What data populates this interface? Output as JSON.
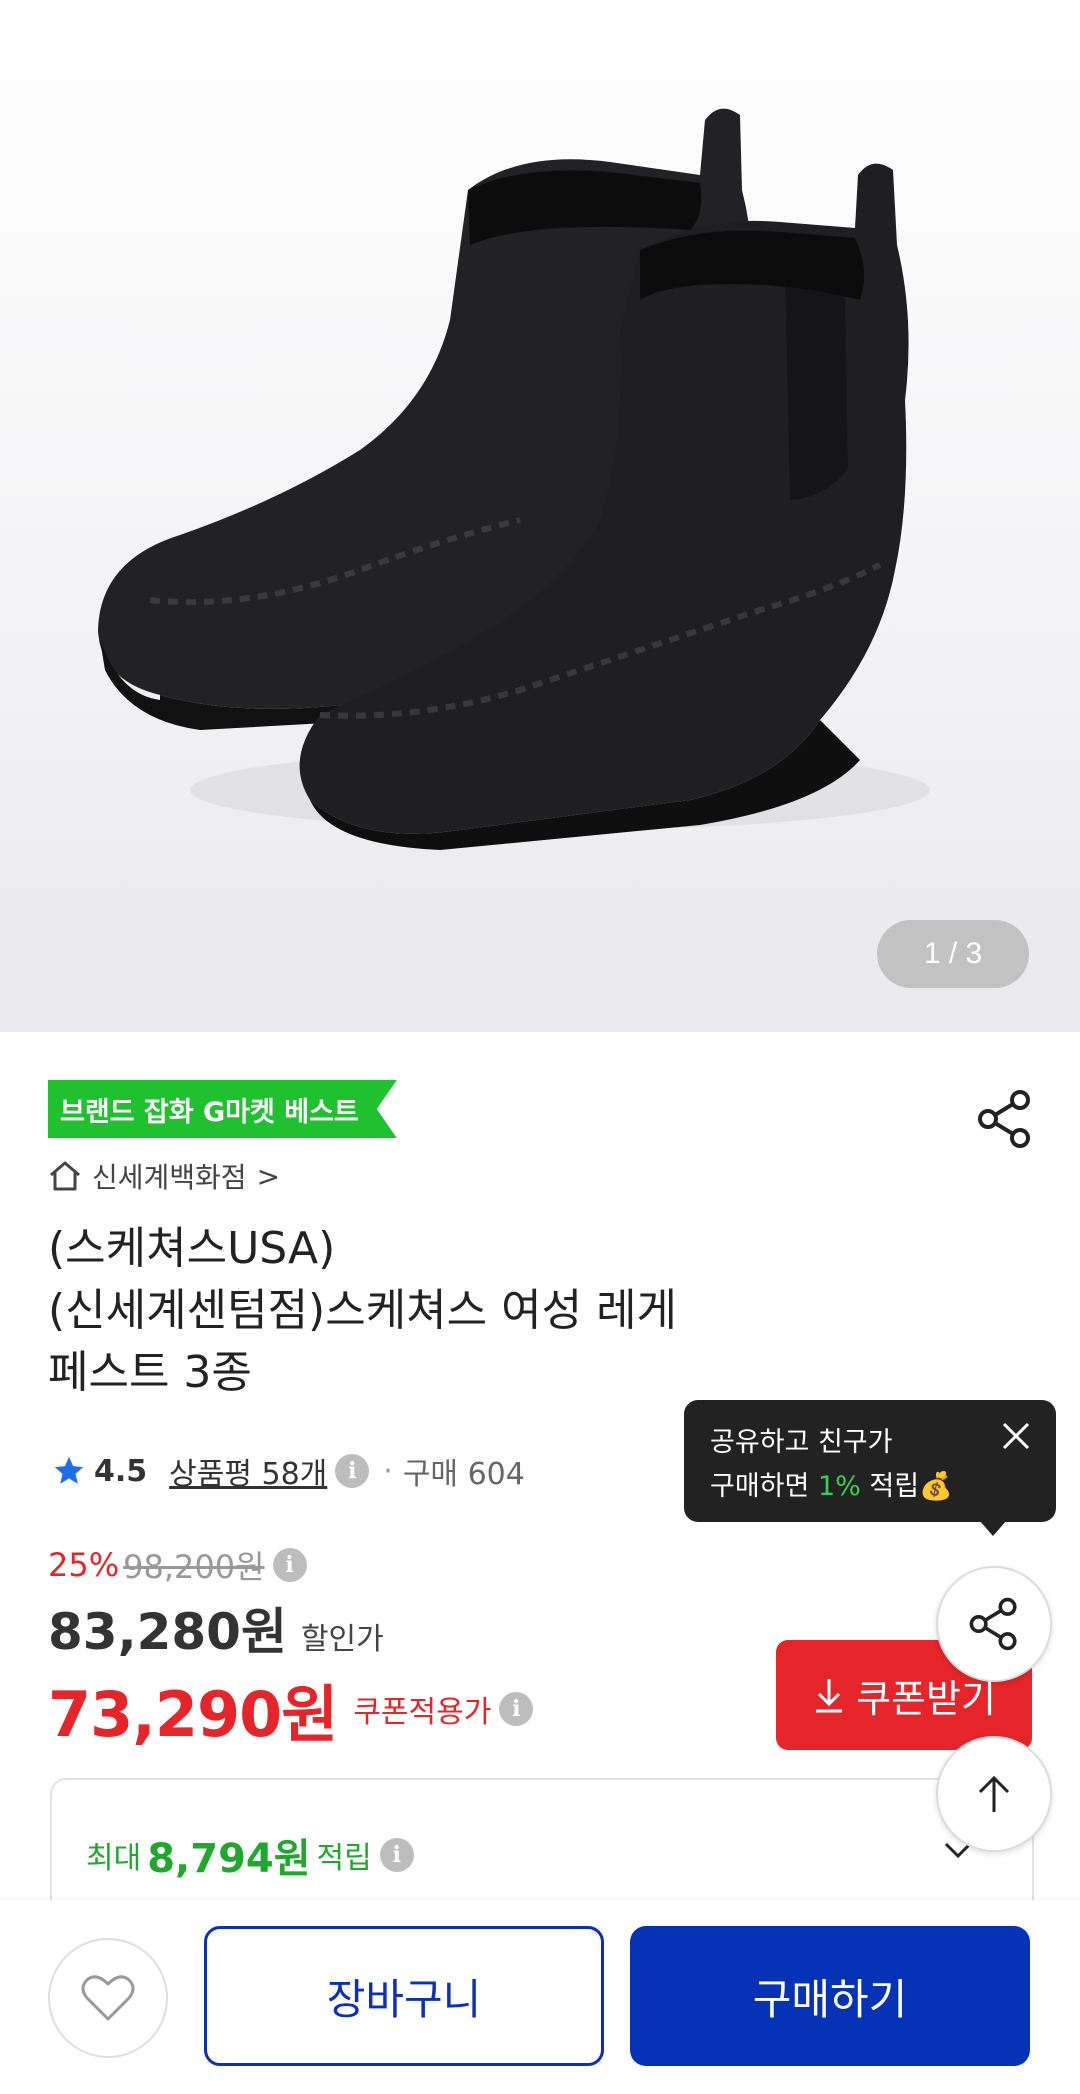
{
  "gallery": {
    "pager": "1 / 3",
    "image_alt": "black chelsea ankle boots"
  },
  "badge": {
    "text": "브랜드 잡화 G마켓 베스트"
  },
  "store": {
    "name": "신세계백화점",
    "chevron": ">"
  },
  "product": {
    "title_lines": [
      "(스케쳐스USA)",
      "(신세계센텀점)스케쳐스 여성 레게",
      "페스트 3종"
    ]
  },
  "rating": {
    "score": "4.5",
    "reviews_label": "상품평 58개",
    "dot": "·",
    "purchase_label": "구매 604"
  },
  "tooltip": {
    "line1": "공유하고 친구가",
    "line2_prefix": "구매하면 ",
    "line2_pct": "1%",
    "line2_suffix": " 적립",
    "emoji": "💰"
  },
  "pricing": {
    "discount_rate": "25%",
    "original_price": "98,200원",
    "sale_price": "83,280원",
    "sale_label": "할인가",
    "coupon_price": "73,290원",
    "coupon_label": "쿠폰적용가",
    "coupon_button": "쿠폰받기"
  },
  "points": {
    "prefix": "최대",
    "amount": "8,794원",
    "suffix": "적립"
  },
  "actions": {
    "cart": "장바구니",
    "buy": "구매하기"
  },
  "colors": {
    "accent_red": "#e5252a",
    "brand_blue": "#0632b5",
    "badge_green": "#1fc12f",
    "points_green": "#1fa82d"
  }
}
